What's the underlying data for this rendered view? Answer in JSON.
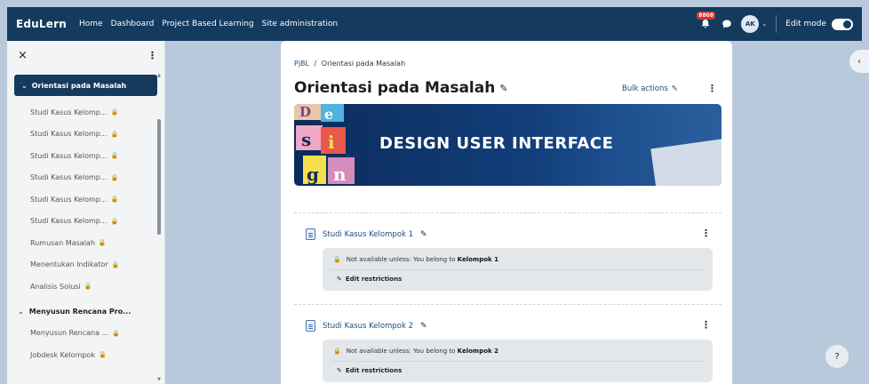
{
  "navbar": {
    "brand": "EduLern",
    "links": [
      "Home",
      "Dashboard",
      "Project Based Learning",
      "Site administration"
    ],
    "notification_count": "8808",
    "avatar_initials": "AK",
    "edit_mode_label": "Edit mode",
    "edit_mode_on": true
  },
  "drawer": {
    "close": "×",
    "active_section": "Orientasi pada Masalah",
    "active_items": [
      {
        "label": "Studi Kasus Kelomp...",
        "locked": true
      },
      {
        "label": "Studi Kasus Kelomp...",
        "locked": true
      },
      {
        "label": "Studi Kasus Kelomp...",
        "locked": true
      },
      {
        "label": "Studi Kasus Kelomp...",
        "locked": true
      },
      {
        "label": "Studi Kasus Kelomp...",
        "locked": true
      },
      {
        "label": "Studi Kasus Kelomp...",
        "locked": true
      },
      {
        "label": "Rumusan Masalah",
        "locked": true
      },
      {
        "label": "Menentukan Indikator",
        "locked": true
      },
      {
        "label": "Analisis Solusi",
        "locked": true
      }
    ],
    "next_section": "Menyusun Rencana Pro...",
    "next_items": [
      {
        "label": "Menyusun Rencana ...",
        "locked": true
      },
      {
        "label": "Jobdesk Kelompok",
        "locked": true
      }
    ]
  },
  "main": {
    "breadcrumb_root": "PjBL",
    "breadcrumb_sep": "/",
    "breadcrumb_current": "Orientasi pada Masalah",
    "title": "Orientasi pada Masalah",
    "bulk_actions": "Bulk actions",
    "banner_text": "DESIGN USER INTERFACE",
    "activities": [
      {
        "name": "Studi Kasus Kelompok 1",
        "restriction_prefix": "Not available unless: You belong to",
        "restriction_group": "Kelompok 1",
        "edit_label": "Edit restrictions"
      },
      {
        "name": "Studi Kasus Kelompok 2",
        "restriction_prefix": "Not available unless: You belong to",
        "restriction_group": "Kelompok 2",
        "edit_label": "Edit restrictions"
      }
    ]
  },
  "help_label": "?",
  "drawer_toggle": "‹"
}
